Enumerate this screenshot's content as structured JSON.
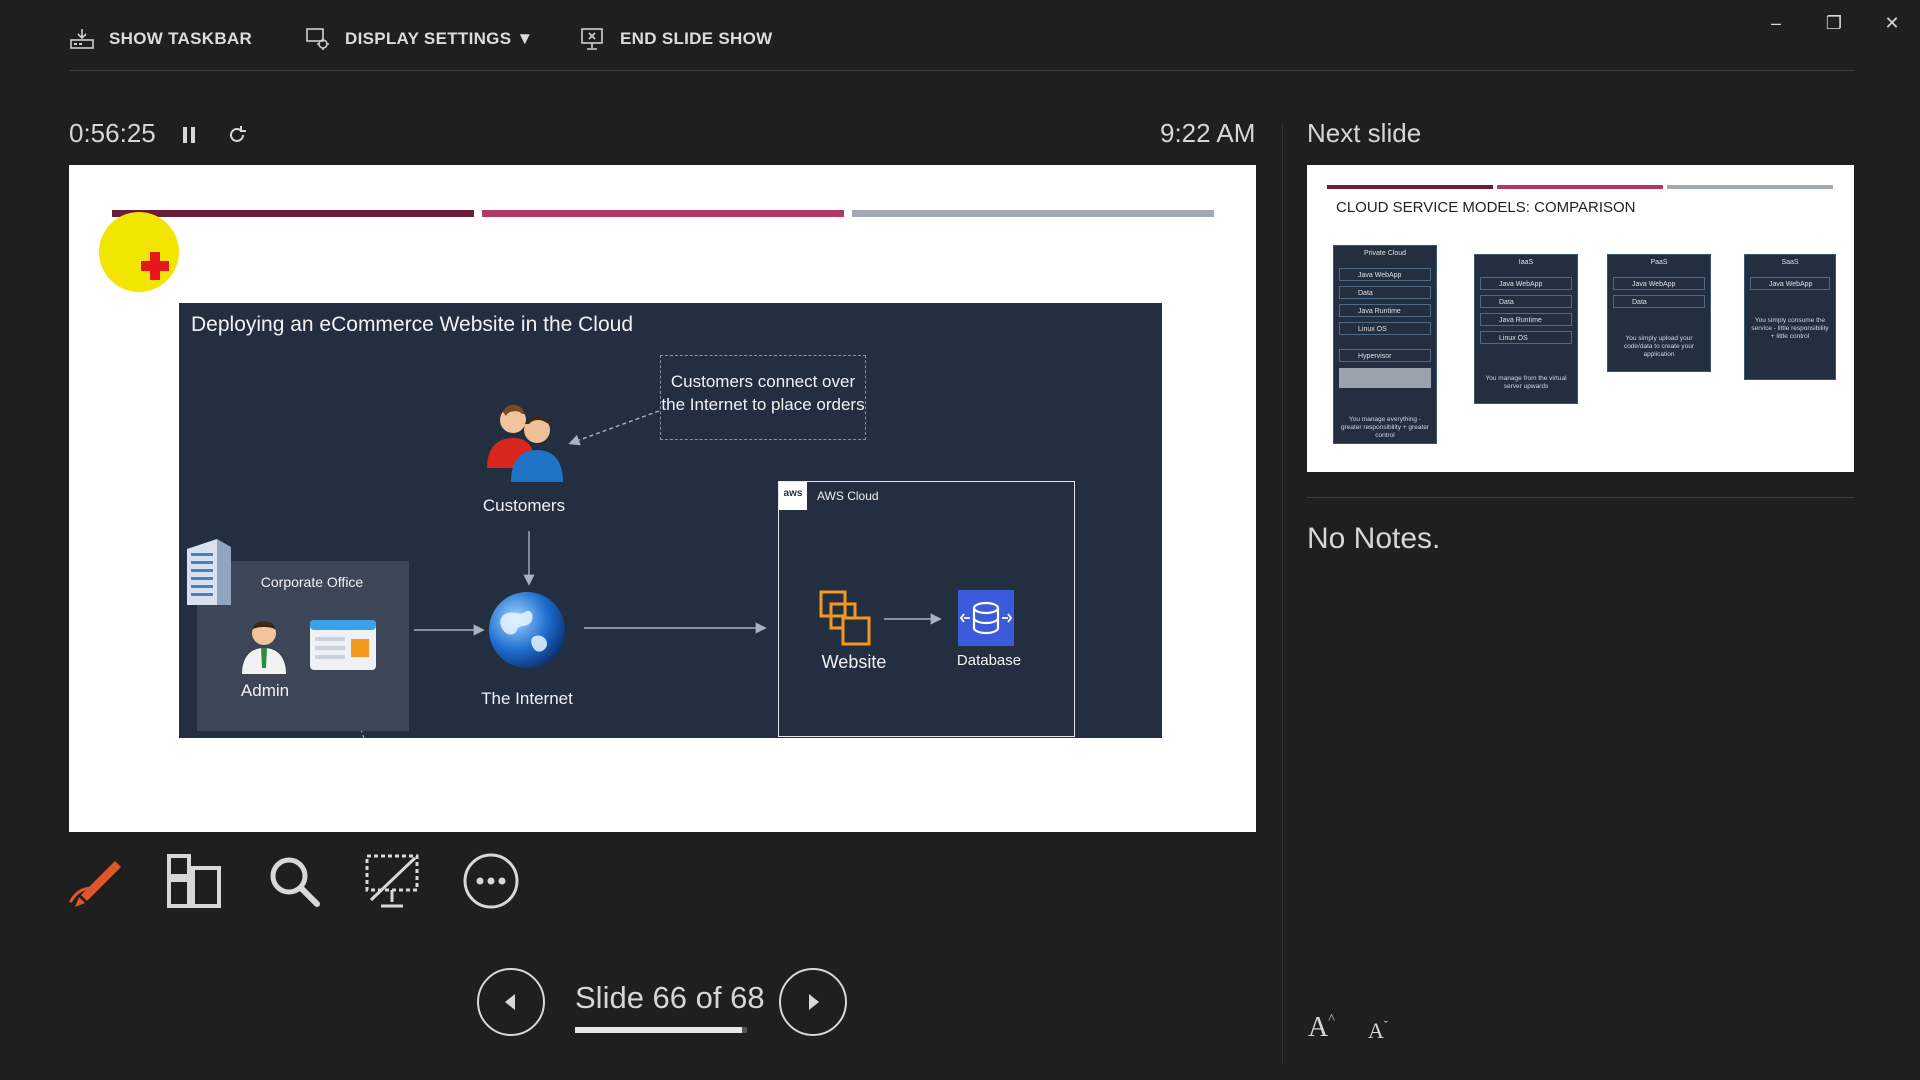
{
  "toolbar": {
    "show_taskbar": "SHOW TASKBAR",
    "display_settings": "DISPLAY SETTINGS ▼",
    "end_slide_show": "END SLIDE SHOW"
  },
  "window": {
    "minimize": "–",
    "restore": "❐",
    "close": "✕"
  },
  "timer": "0:56:25",
  "clock": "9:22 AM",
  "current_slide": {
    "progress_bar_colors": [
      "#6b1e3c",
      "#b13a64",
      "#a3a9b3"
    ],
    "diagram": {
      "title": "Deploying an eCommerce Website in the Cloud",
      "callout": "Customers connect over the Internet to place orders",
      "customers": "Customers",
      "corporate_office": "Corporate Office",
      "admin": "Admin",
      "internet": "The Internet",
      "aws_cloud": "AWS Cloud",
      "aws_logo": "aws",
      "website": "Website",
      "database": "Database"
    }
  },
  "next_slide": {
    "label": "Next slide",
    "title": "CLOUD SERVICE MODELS: COMPARISON",
    "cards": [
      {
        "title": "Private Cloud",
        "rows": [
          "Java WebApp",
          "Data",
          "Java Runtime",
          "Linux OS",
          "Hypervisor"
        ],
        "footer": "You manage everything - greater responsibility + greater control"
      },
      {
        "title": "IaaS",
        "rows": [
          "Java WebApp",
          "Data",
          "Java Runtime",
          "Linux OS"
        ],
        "footer": "You manage from the virtual server upwards"
      },
      {
        "title": "PaaS",
        "rows": [
          "Java WebApp",
          "Data"
        ],
        "footer": "You simply upload your code/data to create your application"
      },
      {
        "title": "SaaS",
        "rows": [
          "Java WebApp"
        ],
        "footer": "You simply consume the service - little responsibility + little control"
      }
    ]
  },
  "notes": "No Notes.",
  "navigation": {
    "slide_label": "Slide 66 of 68",
    "current": 66,
    "total": 68
  },
  "font_controls": {
    "increase": "A",
    "decrease": "A"
  },
  "icons": [
    "taskbar-icon",
    "display-settings-icon",
    "end-show-icon",
    "pause-icon",
    "restart-icon",
    "pen-icon",
    "see-all-slides-icon",
    "zoom-icon",
    "black-screen-icon",
    "more-options-icon",
    "previous-arrow-icon",
    "next-arrow-icon"
  ]
}
